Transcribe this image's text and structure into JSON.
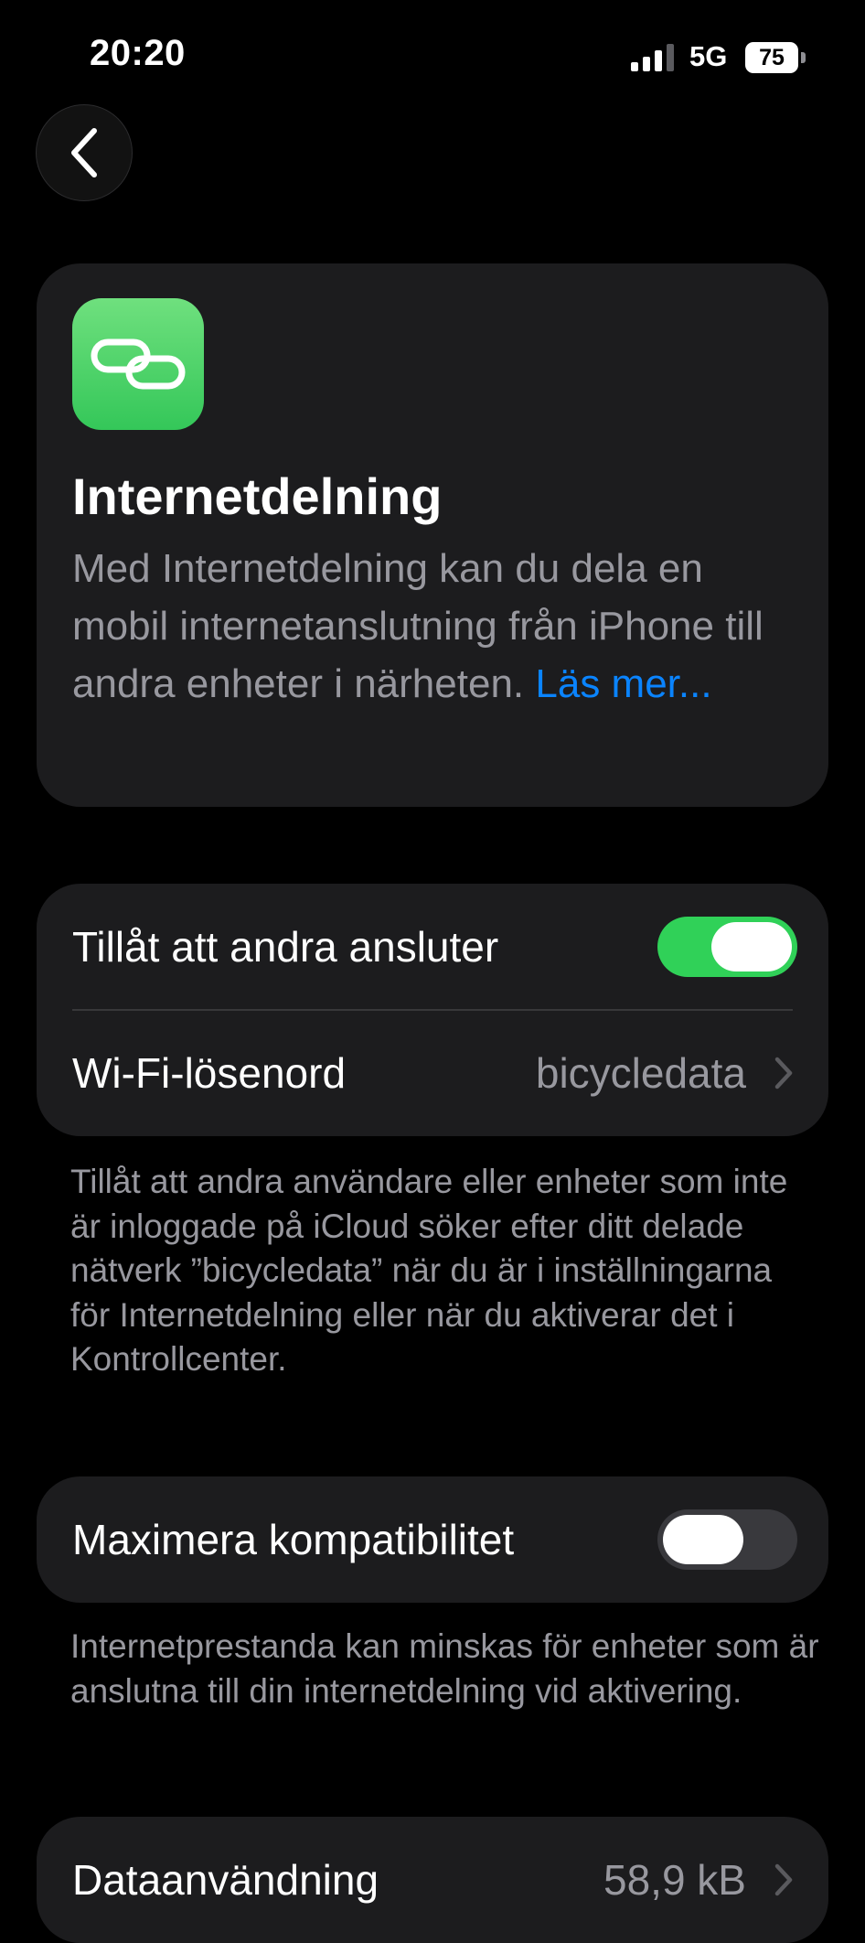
{
  "status_bar": {
    "time": "20:20",
    "network": "5G",
    "battery": "75"
  },
  "hero": {
    "title": "Internetdelning",
    "description": "Med Internetdelning kan du dela en mobil internetanslutning från iPhone till andra enheter i närheten.",
    "read_more": "Läs mer..."
  },
  "allow_group": {
    "allow_label": "Tillåt att andra ansluter",
    "allow_on": true,
    "wifi_label": "Wi-Fi-lösenord",
    "wifi_value": "bicycledata",
    "footer": "Tillåt att andra användare eller enheter som inte är inloggade på iCloud söker efter ditt delade nätverk ”bicycledata” när du är i inställningarna för Internetdelning eller när du aktiverar det i Kontrollcenter."
  },
  "compat_group": {
    "label": "Maximera kompatibilitet",
    "on": false,
    "footer": "Internetprestanda kan minskas för enheter som är anslutna till din internetdelning vid aktivering."
  },
  "data_usage": {
    "label": "Dataanvändning",
    "value": "58,9 kB"
  },
  "colors": {
    "accent": "#0a84ff",
    "toggle_on": "#30d158",
    "card_bg": "#1c1c1e",
    "secondary_text": "#98989f"
  },
  "icons": [
    "signal-icon",
    "battery-icon",
    "back-chevron-icon",
    "link-icon",
    "chevron-right-icon"
  ]
}
